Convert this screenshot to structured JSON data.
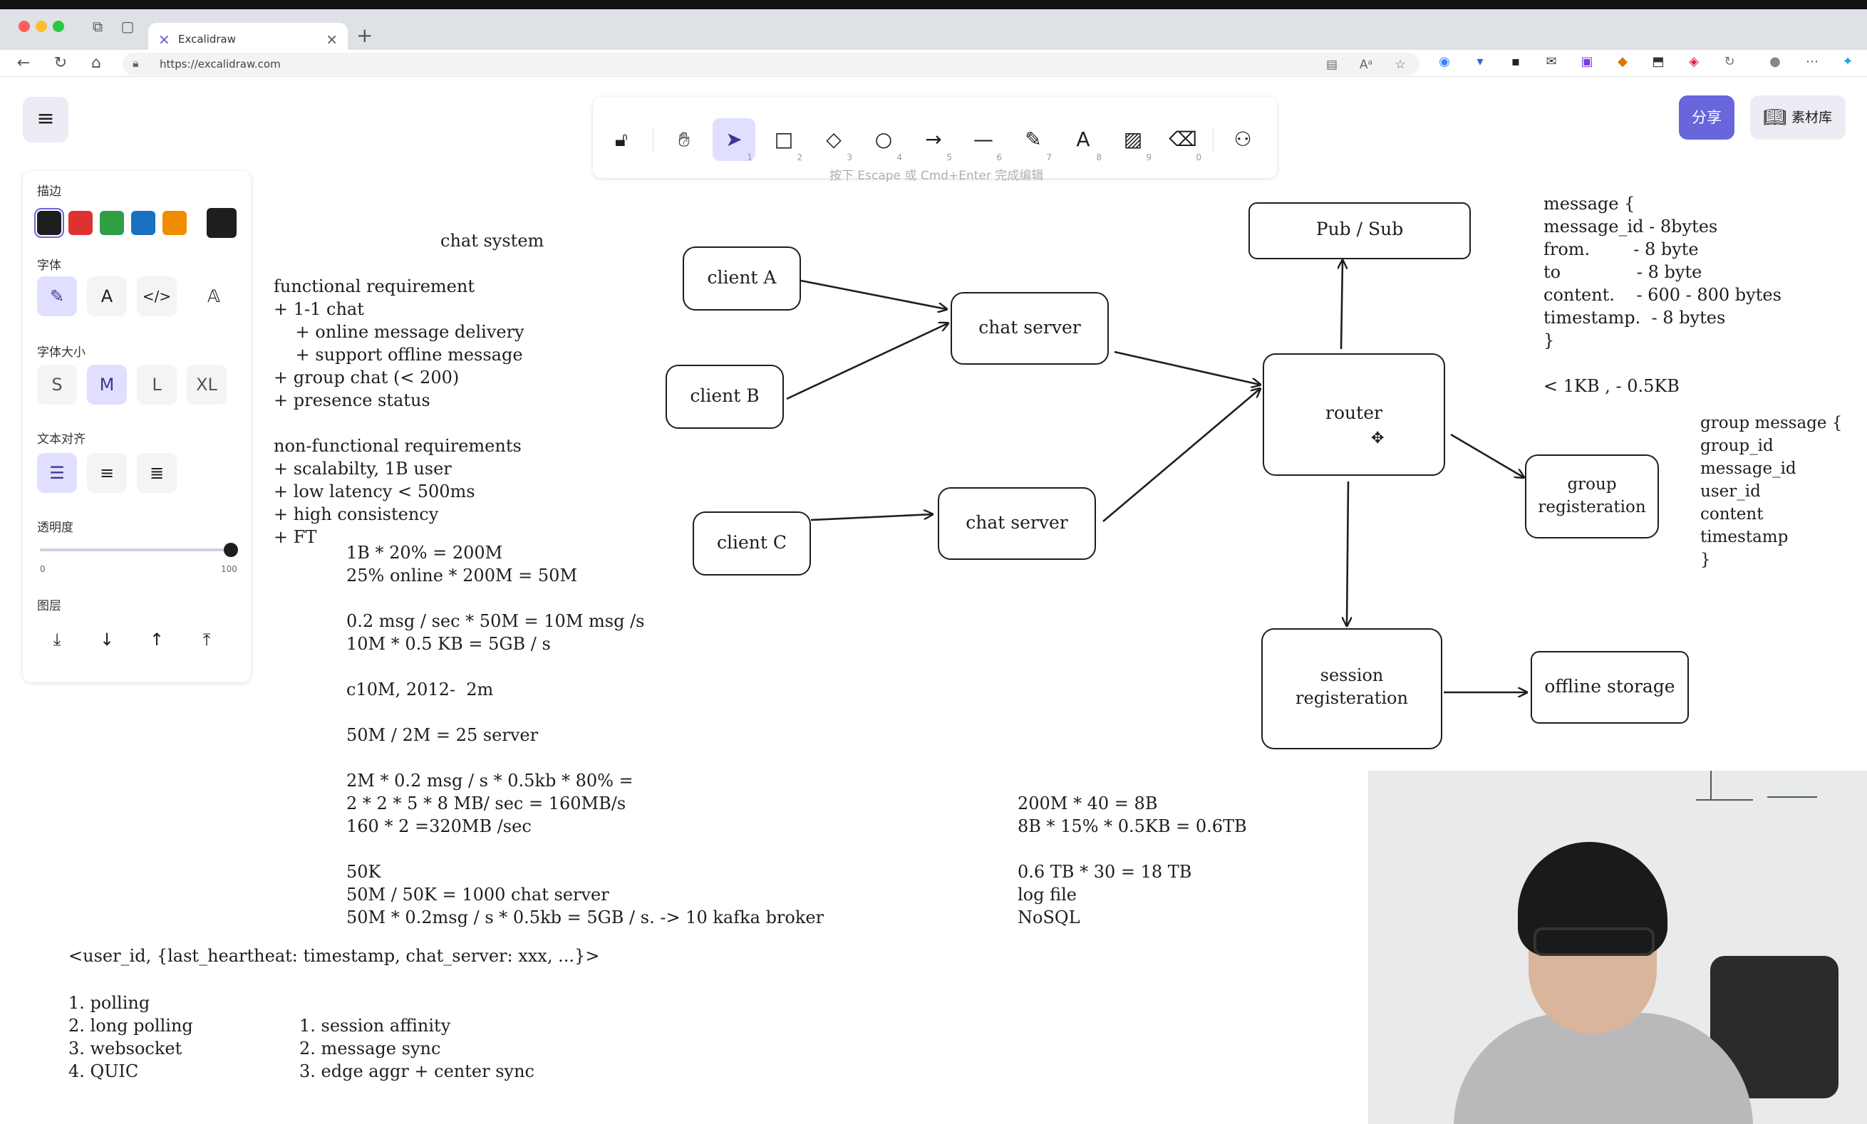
{
  "browser": {
    "tab_title": "Excalidraw",
    "url": "https://excalidraw.com"
  },
  "toolbar": {
    "tools": [
      {
        "name": "lock-icon",
        "num": ""
      },
      {
        "name": "hand-icon",
        "num": ""
      },
      {
        "name": "selection-icon",
        "num": "1"
      },
      {
        "name": "rectangle-icon",
        "num": "2"
      },
      {
        "name": "diamond-icon",
        "num": "3"
      },
      {
        "name": "ellipse-icon",
        "num": "4"
      },
      {
        "name": "arrow-icon",
        "num": "5"
      },
      {
        "name": "line-icon",
        "num": "6"
      },
      {
        "name": "draw-icon",
        "num": "7"
      },
      {
        "name": "text-icon",
        "num": "8"
      },
      {
        "name": "image-icon",
        "num": "9"
      },
      {
        "name": "eraser-icon",
        "num": "0"
      },
      {
        "name": "extra-tools-icon",
        "num": ""
      }
    ],
    "hint": "按下 Escape 或 Cmd+Enter 完成编辑"
  },
  "header": {
    "share_label": "分享",
    "library_label": "素材库"
  },
  "props": {
    "stroke_label": "描边",
    "stroke_colors": [
      "#1e1e1e",
      "#e03131",
      "#2f9e44",
      "#1971c2",
      "#f08c00"
    ],
    "current_color": "#1e1e1e",
    "font_label": "字体",
    "font_size_label": "字体大小",
    "font_sizes": [
      "S",
      "M",
      "L",
      "XL"
    ],
    "align_label": "文本对齐",
    "opacity_label": "透明度",
    "opacity_min": "0",
    "opacity_max": "100",
    "layer_label": "图层"
  },
  "notes": {
    "title": "chat system",
    "requirements": "functional requirement\n+ 1-1 chat\n    + online message delivery\n    + support offline message\n+ group chat (< 200)\n+ presence status\n\nnon-functional requirements\n+ scalabilty, 1B user\n+ low latency < 500ms\n+ high consistency\n+ FT",
    "calc": "1B * 20% = 200M\n25% online * 200M = 50M\n\n0.2 msg / sec * 50M = 10M msg /s\n10M * 0.5 KB = 5GB / s\n\nc10M, 2012-  2m\n\n50M / 2M = 25 server\n\n2M * 0.2 msg / s * 0.5kb * 80% =\n2 * 2 * 5 * 8 MB/ sec = 160MB/s\n160 * 2 =320MB /sec\n\n50K\n50M / 50K = 1000 chat server\n50M * 0.2msg / s * 0.5kb = 5GB / s. -> 10 kafka broker",
    "heartbeat": "<user_id, {last_heartheat: timestamp, chat_server: xxx, ...}>",
    "protocols": "1. polling\n2. long polling\n3. websocket\n4. QUIC",
    "sync": "1. session affinity\n2. message sync\n3. edge aggr + center sync",
    "storage_calc": "200M * 40 = 8B\n8B * 15% * 0.5KB = 0.6TB\n\n0.6 TB * 30 = 18 TB\nlog file\nNoSQL",
    "message_schema": "message {\nmessage_id - 8bytes\nfrom.        - 8 byte\nto              - 8 byte\ncontent.    - 600 - 800 bytes\ntimestamp.  - 8 bytes\n}\n\n< 1KB , - 0.5KB",
    "group_schema": "group message {\ngroup_id\nmessage_id\nuser_id\ncontent\ntimestamp\n}"
  },
  "diagram": {
    "client_a": "client A",
    "client_b": "client B",
    "client_c": "client C",
    "chat_server_1": "chat server",
    "chat_server_2": "chat server",
    "router": "router",
    "pubsub": "Pub / Sub",
    "group_reg": "group\nregisteration",
    "session_reg": "session\nregisteration",
    "offline_storage": "offline storage"
  }
}
